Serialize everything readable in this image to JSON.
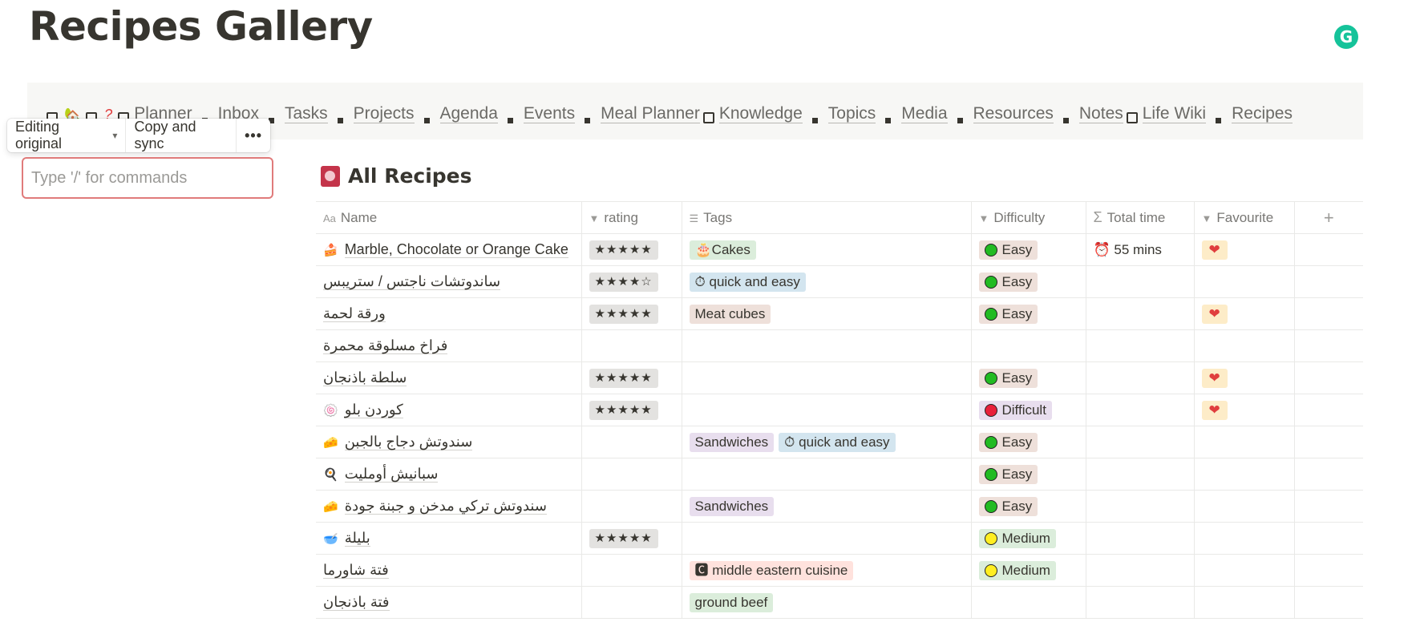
{
  "page": {
    "title": "Recipes Gallery"
  },
  "nav": {
    "emoji": "🏡",
    "question": "?",
    "links": [
      "Planner",
      "Inbox",
      "Tasks",
      "Projects",
      "Agenda",
      "Events",
      "Meal Planner",
      "Knowledge",
      "Topics",
      "Media",
      "Resources",
      "Notes",
      "Life Wiki",
      "Recipes"
    ]
  },
  "toolbar": {
    "editing_label": "Editing original",
    "copy_sync_label": "Copy and sync",
    "more_label": "•••"
  },
  "command": {
    "placeholder": "Type '/' for commands"
  },
  "database": {
    "title": "All Recipes",
    "columns": {
      "name": "Name",
      "rating": "rating",
      "tags": "Tags",
      "difficulty": "Difficulty",
      "total_time": "Total time",
      "favourite": "Favourite",
      "add": "+"
    },
    "rows": [
      {
        "icon": "🍰",
        "name": "Marble, Chocolate or Orange Cake",
        "rating": "★★★★★",
        "tags": [
          {
            "label": "🎂Cakes",
            "color": "teal"
          }
        ],
        "difficulty": "Easy",
        "time": "⏰ 55 mins",
        "favourite": "❤"
      },
      {
        "icon": "",
        "name": "ساندوتشات ناجتس / ستريبس",
        "rating": "★★★★☆",
        "tags": [
          {
            "label": "⏱ quick and easy",
            "color": "blue"
          }
        ],
        "difficulty": "Easy",
        "time": "",
        "favourite": ""
      },
      {
        "icon": "",
        "name": "ورقة لحمة",
        "rating": "★★★★★",
        "tags": [
          {
            "label": "Meat cubes",
            "color": "brown"
          }
        ],
        "difficulty": "Easy",
        "time": "",
        "favourite": "❤"
      },
      {
        "icon": "",
        "name": "فراخ مسلوقة محمرة",
        "rating": "",
        "tags": [],
        "difficulty": "",
        "time": "",
        "favourite": ""
      },
      {
        "icon": "",
        "name": "سلطة باذنجان",
        "rating": "★★★★★",
        "tags": [],
        "difficulty": "Easy",
        "time": "",
        "favourite": "❤"
      },
      {
        "icon": "🍥",
        "name": "كوردن بلو",
        "rating": "★★★★★",
        "tags": [],
        "difficulty": "Difficult",
        "time": "",
        "favourite": "❤"
      },
      {
        "icon": "🧀",
        "name": "سندوتش دجاج بالجبن",
        "rating": "",
        "tags": [
          {
            "label": "Sandwiches",
            "color": "purple"
          },
          {
            "label": "⏱ quick and easy",
            "color": "blue"
          }
        ],
        "difficulty": "Easy",
        "time": "",
        "favourite": ""
      },
      {
        "icon": "🍳",
        "name": "سبانيش أومليت",
        "rating": "",
        "tags": [],
        "difficulty": "Easy",
        "time": "",
        "favourite": ""
      },
      {
        "icon": "🧀",
        "name": "سندوتش تركي مدخن و جبنة جودة",
        "rating": "",
        "tags": [
          {
            "label": "Sandwiches",
            "color": "purple"
          }
        ],
        "difficulty": "Easy",
        "time": "",
        "favourite": ""
      },
      {
        "icon": "🥣",
        "name": "بليلة",
        "rating": "★★★★★",
        "tags": [],
        "difficulty": "Medium",
        "time": "",
        "favourite": ""
      },
      {
        "icon": "",
        "name": "فتة شاورما",
        "rating": "",
        "tags": [
          {
            "label": "🅲 middle eastern cuisine",
            "color": "red"
          }
        ],
        "difficulty": "Medium",
        "time": "",
        "favourite": ""
      },
      {
        "icon": "",
        "name": "فتة باذنجان",
        "rating": "",
        "tags": [
          {
            "label": "ground beef",
            "color": "teal"
          }
        ],
        "difficulty": "",
        "time": "",
        "favourite": ""
      }
    ]
  },
  "colors": {
    "easy": "#22bb22",
    "medium": "#ffee22",
    "difficult": "#e8203a",
    "difficulty_pill_easy": "#eee0da",
    "difficulty_pill_medium": "#dbeddb",
    "difficulty_pill_difficult": "#e8deee"
  },
  "icons": {
    "grammarly": "G"
  }
}
